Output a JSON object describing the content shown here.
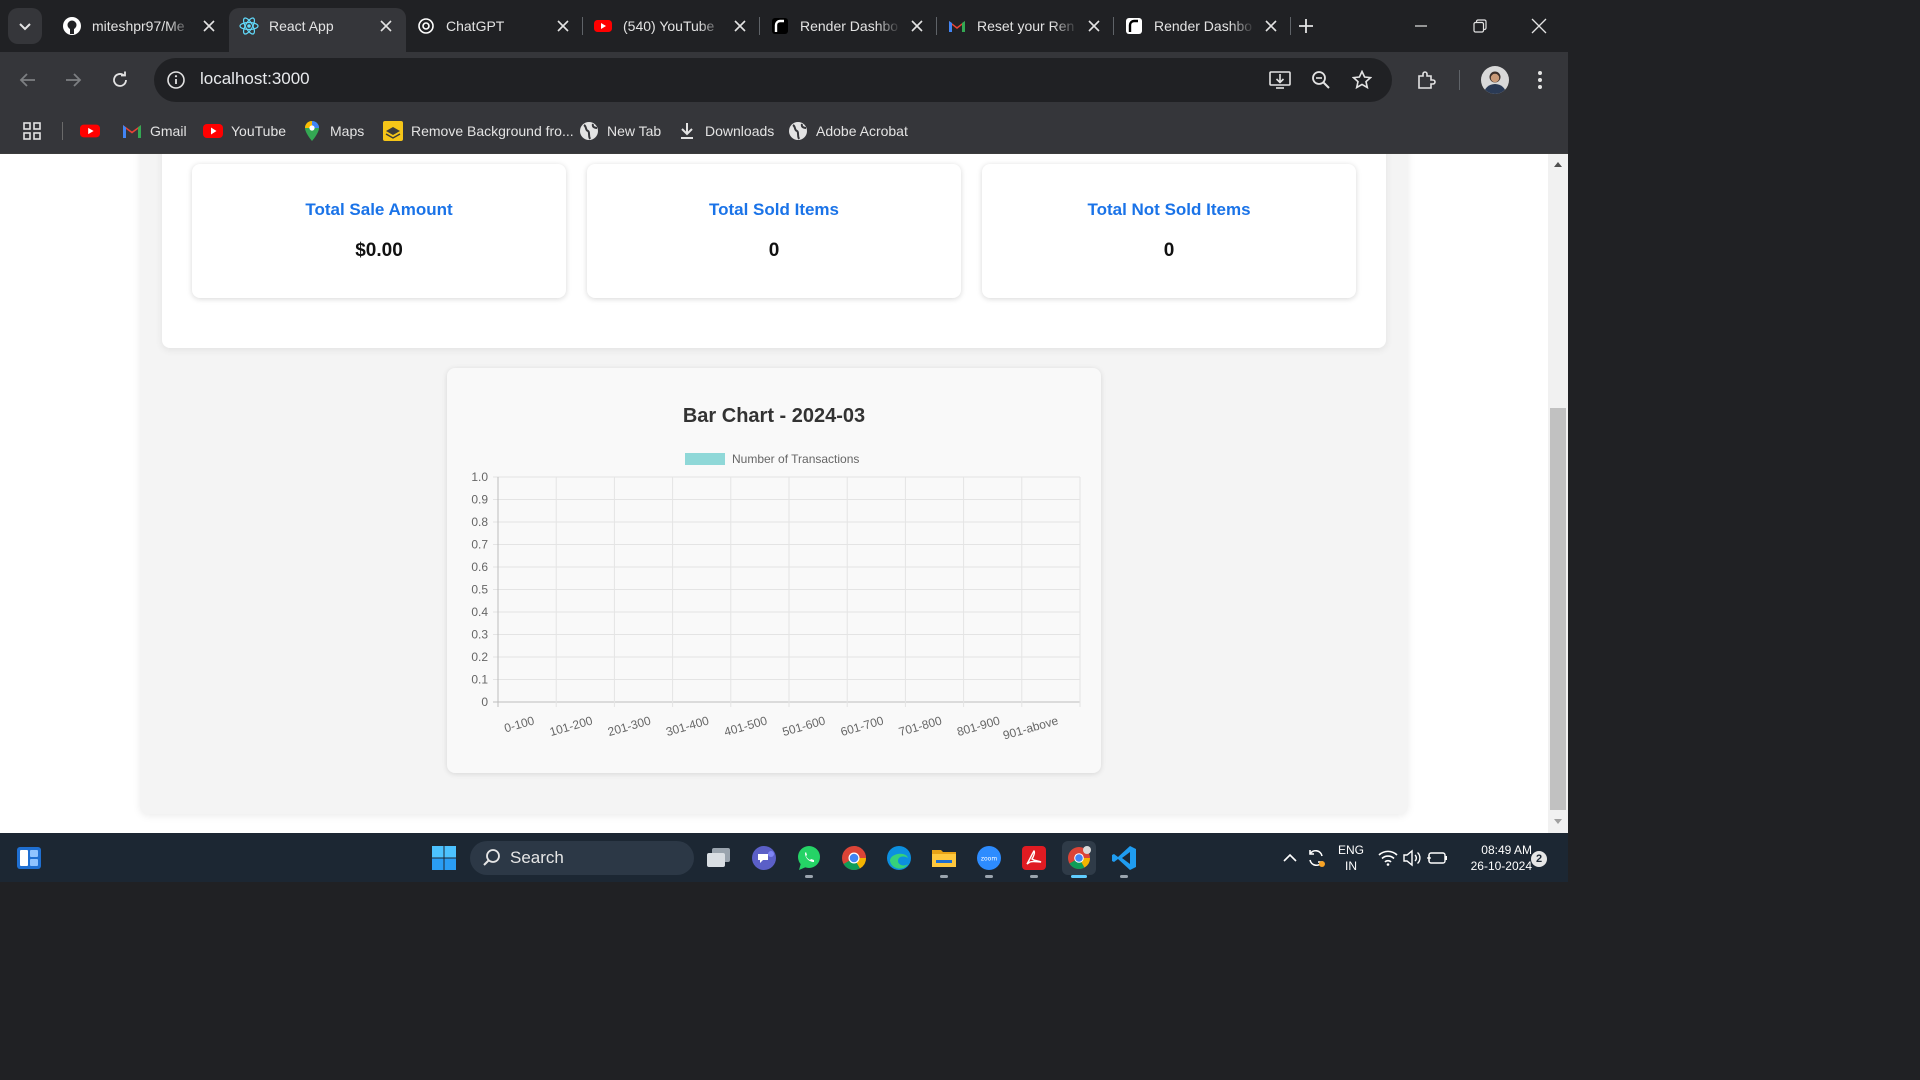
{
  "browser": {
    "tabs": [
      {
        "title": "miteshpr97/Me",
        "icon": "github-icon",
        "active": false
      },
      {
        "title": "React App",
        "icon": "react-icon",
        "active": true
      },
      {
        "title": "ChatGPT",
        "icon": "chatgpt-icon",
        "active": false
      },
      {
        "title": "(540) YouTube",
        "icon": "youtube-icon",
        "active": false
      },
      {
        "title": "Render Dashbo",
        "icon": "render-icon",
        "active": false
      },
      {
        "title": "Reset your Ren",
        "icon": "gmail-icon",
        "active": false
      },
      {
        "title": "Render Dashbo",
        "icon": "render-icon",
        "active": false
      }
    ],
    "url": "localhost:3000",
    "bookmarks": [
      {
        "label": "",
        "icon": "youtube-icon"
      },
      {
        "label": "Gmail",
        "icon": "gmail-icon"
      },
      {
        "label": "YouTube",
        "icon": "youtube-icon"
      },
      {
        "label": "Maps",
        "icon": "maps-icon"
      },
      {
        "label": "Remove Background fro...",
        "icon": "remove-bg-icon"
      },
      {
        "label": "New Tab",
        "icon": "globe-icon"
      },
      {
        "label": "Downloads",
        "icon": "download-icon"
      },
      {
        "label": "Adobe Acrobat",
        "icon": "globe-icon"
      }
    ]
  },
  "page": {
    "stats": [
      {
        "title": "Total Sale Amount",
        "value": "$0.00"
      },
      {
        "title": "Total Sold Items",
        "value": "0"
      },
      {
        "title": "Total Not Sold Items",
        "value": "0"
      }
    ]
  },
  "chart_data": {
    "type": "bar",
    "title": "Bar Chart - 2024-03",
    "categories": [
      "0-100",
      "101-200",
      "201-300",
      "301-400",
      "401-500",
      "501-600",
      "601-700",
      "701-800",
      "801-900",
      "901-above"
    ],
    "series": [
      {
        "name": "Number of Transactions",
        "values": [
          0,
          0,
          0,
          0,
          0,
          0,
          0,
          0,
          0,
          0
        ],
        "color": "#8fd8d8"
      }
    ],
    "yticks": [
      "0",
      "0.1",
      "0.2",
      "0.3",
      "0.4",
      "0.5",
      "0.6",
      "0.7",
      "0.8",
      "0.9",
      "1.0"
    ],
    "ylim": [
      0,
      1
    ],
    "grid": true,
    "legend": "top"
  },
  "taskbar": {
    "search_label": "Search",
    "apps": [
      "task-view-icon",
      "teams-icon",
      "whatsapp-icon",
      "chrome-icon",
      "edge-icon",
      "file-explorer-icon",
      "zoom-icon",
      "acrobat-icon",
      "chrome-profile-icon",
      "vscode-icon"
    ],
    "lang_line1": "ENG",
    "lang_line2": "IN",
    "time": "08:49 AM",
    "date": "26-10-2024",
    "notification_count": "2"
  },
  "colors": {
    "accent": "#1a73e8",
    "bar": "#8fd8d8",
    "browser_dark": "#202124",
    "toolbar": "#35363a"
  }
}
